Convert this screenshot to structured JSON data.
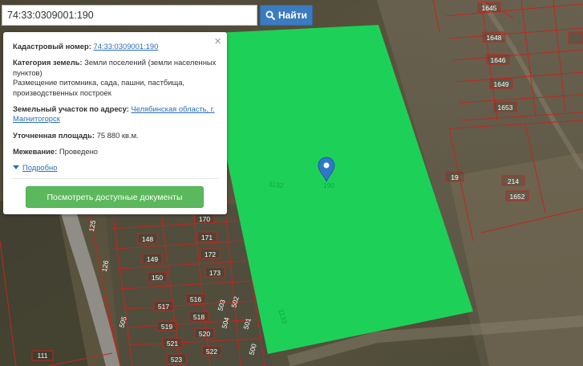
{
  "search": {
    "value": "74:33:0309001:190",
    "button_label": "Найти"
  },
  "info_panel": {
    "cadastral_label": "Кадастровый номер:",
    "cadastral_value": "74:33:0309001:190",
    "category_label": "Категория земель:",
    "category_value": "Земли поселений (земли населенных пунктов)",
    "permitted_use": "Размещение питомника, сада, пашни, пастбища, производственных построек",
    "address_label": "Земельный участок по адресу:",
    "address_value": "Челябинская область, г. Магнитогорск",
    "area_label": "Уточненная площадь:",
    "area_value": "75 880 кв.м.",
    "survey_label": "Межевание:",
    "survey_value": "Проведено",
    "more_label": "Подробно",
    "docs_button": "Посмотреть доступные документы",
    "close_symbol": "×"
  },
  "map": {
    "selected_parcel_color": "#1bd65a",
    "boundary_color": "#c0271f",
    "marker_color": "#2f78c8",
    "parcel_labels": {
      "p1645": "1645",
      "p1648": "1648",
      "p1646": "1646",
      "p1649": "1649",
      "p1653": "1653",
      "p19": "19",
      "p214": "214",
      "p1652": "1652",
      "p1132a": "1132",
      "p190": "190",
      "p1133": "1133",
      "p170": "170",
      "p148": "148",
      "p171": "171",
      "p172": "172",
      "p149": "149",
      "p173": "173",
      "p150": "150",
      "p125": "125",
      "p126": "126",
      "p516": "516",
      "p517": "517",
      "p518": "518",
      "p519": "519",
      "p520": "520",
      "p521": "521",
      "p522": "522",
      "p523": "523",
      "p500": "500",
      "p501": "501",
      "p502": "502",
      "p503": "503",
      "p504": "504",
      "p505": "505",
      "p111": "111"
    }
  }
}
